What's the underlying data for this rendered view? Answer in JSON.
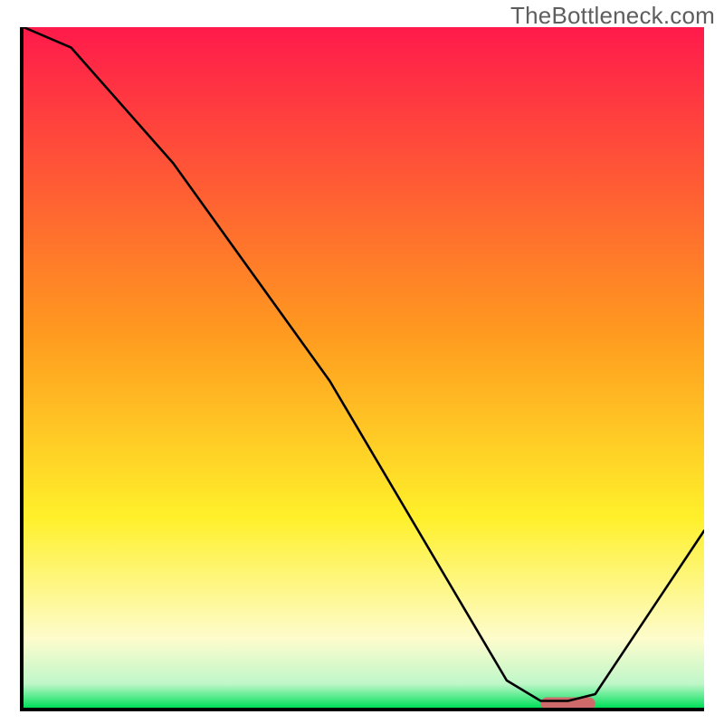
{
  "watermark": {
    "text": "TheBottleneck.com"
  },
  "chart_data": {
    "type": "line",
    "title": "",
    "xlabel": "",
    "ylabel": "",
    "xlim": [
      0,
      100
    ],
    "ylim": [
      0,
      100
    ],
    "grid": false,
    "legend": false,
    "background_gradient": {
      "stops": [
        {
          "offset": 0.0,
          "color": "#ff1a4b"
        },
        {
          "offset": 0.45,
          "color": "#ff9a1f"
        },
        {
          "offset": 0.72,
          "color": "#fff02a"
        },
        {
          "offset": 0.9,
          "color": "#fdfccd"
        },
        {
          "offset": 0.965,
          "color": "#bff7c9"
        },
        {
          "offset": 1.0,
          "color": "#00e05a"
        }
      ]
    },
    "series": [
      {
        "name": "bottleneck-curve",
        "color": "#000000",
        "width": 2.6,
        "x": [
          0,
          7,
          22,
          45,
          71,
          76,
          80,
          84,
          94,
          100
        ],
        "y": [
          100,
          97,
          80,
          48,
          4,
          1,
          1,
          2,
          17,
          26
        ]
      }
    ],
    "marker": {
      "name": "optimal-range-marker",
      "color": "#cf6a6a",
      "x_start": 76,
      "x_end": 84,
      "y": 0.6,
      "thickness": 14,
      "radius": 7
    }
  }
}
